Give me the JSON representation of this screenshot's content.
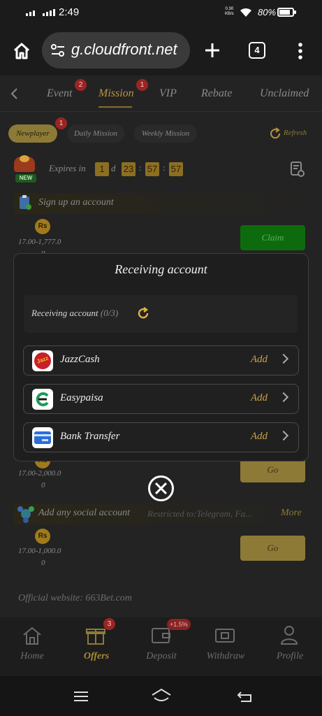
{
  "status_bar": {
    "time": "2:49",
    "net_speed": "0.30",
    "net_unit": "KB/s",
    "battery": "80%",
    "battery_level": 0.8
  },
  "browser": {
    "url": "g.cloudfront.net",
    "tab_count": "4"
  },
  "tabs": [
    {
      "label": "Event",
      "badge": "2"
    },
    {
      "label": "Mission",
      "badge": "1",
      "active": true
    },
    {
      "label": "VIP"
    },
    {
      "label": "Rebate"
    },
    {
      "label": "Unclaimed"
    }
  ],
  "chips": {
    "newplayer": "Newplayer",
    "newplayer_badge": "1",
    "daily": "Daily Mission",
    "weekly": "Weekly Mission",
    "refresh": "Refresh"
  },
  "expires": {
    "label": "Expires in",
    "days": "1",
    "d": "d",
    "hours": "23",
    "minutes": "57",
    "seconds": "57",
    "sep": ":",
    "new_tag": "NEW"
  },
  "tasks": {
    "signup_title": "Sign up an account",
    "coin": "Rs",
    "signup_range": "17.00-1,777.0",
    "signup_range2": "0",
    "claim": "Claim",
    "task2_range": "17.00-2,000.0",
    "task2_range2": "0",
    "go": "Go",
    "social_title": "Add any social account",
    "social_restricted": "Restricted to:Telegram, Fa...",
    "social_more": "More",
    "social_range": "17.00-1,000.0",
    "social_range2": "0",
    "go2": "Go",
    "official": "Official website: 663Bet.com"
  },
  "modal": {
    "title": "Receiving account",
    "sub_label": "Receiving account",
    "sub_count": "(0/3)",
    "options": [
      {
        "label": "JazzCash",
        "action": "Add",
        "icon_text": "Jazz"
      },
      {
        "label": "Easypaisa",
        "action": "Add"
      },
      {
        "label": "Bank Transfer",
        "action": "Add"
      }
    ]
  },
  "bottom_nav": {
    "home": "Home",
    "offers": "Offers",
    "offers_badge": "3",
    "deposit": "Deposit",
    "deposit_badge": "+1.5%",
    "withdraw": "Withdraw",
    "profile": "Profile"
  },
  "colors": {
    "accent_gold": "#b8963c",
    "claim_green": "#0d6b0d",
    "badge_red": "#9b2424"
  }
}
